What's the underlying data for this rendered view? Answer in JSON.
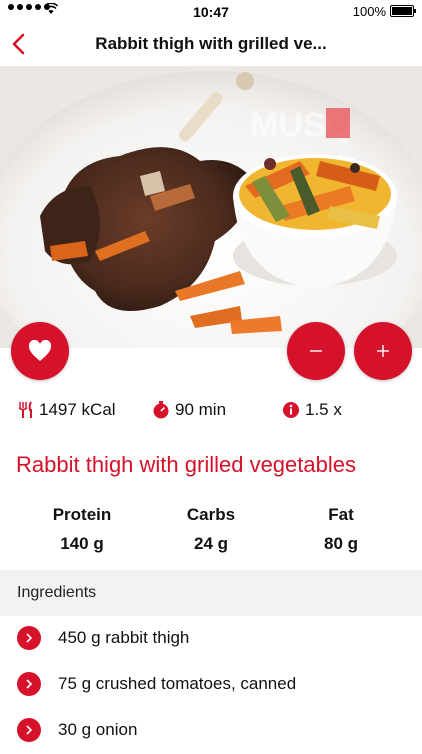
{
  "status_bar": {
    "time": "10:47",
    "battery": "100%"
  },
  "nav": {
    "title": "Rabbit thigh with grilled ve..."
  },
  "hero": {
    "watermark": "MUSQ"
  },
  "stats": {
    "kcal": "1497 kCal",
    "duration": "90 min",
    "factor": "1.5 x"
  },
  "recipe": {
    "title": "Rabbit thigh with grilled vegetables"
  },
  "macros": {
    "protein_label": "Protein",
    "protein_value": "140 g",
    "carbs_label": "Carbs",
    "carbs_value": "24 g",
    "fat_label": "Fat",
    "fat_value": "80 g"
  },
  "ingredients": {
    "header": "Ingredients",
    "items": [
      "450 g rabbit thigh",
      "75 g crushed tomatoes, canned",
      "30 g onion"
    ]
  },
  "colors": {
    "accent": "#d6112a",
    "section_bg": "#f2f2f2"
  }
}
